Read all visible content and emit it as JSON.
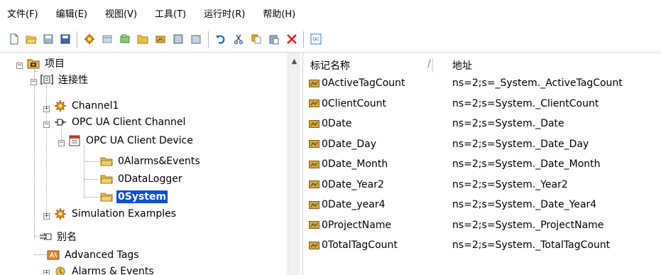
{
  "menu": {
    "items": [
      "文件(F)",
      "编辑(E)",
      "视图(V)",
      "工具(T)",
      "运行时(R)",
      "帮助(H)"
    ]
  },
  "toolbar": {
    "buttons": [
      {
        "icon": "new-file-icon",
        "color": "#ffffff"
      },
      {
        "icon": "open-folder-icon",
        "color": "#f2c744"
      },
      {
        "icon": "save-icon",
        "color": "#9fb6cf"
      },
      {
        "icon": "save-as-icon",
        "color": "#3a67b0"
      },
      {
        "icon": "new-channel-icon",
        "color": "#e89a1c"
      },
      {
        "icon": "new-device-icon",
        "color": "#c9d7e8"
      },
      {
        "icon": "new-tag-group-icon",
        "color": "#8cc47a"
      },
      {
        "icon": "new-folder-icon",
        "color": "#e8c048"
      },
      {
        "icon": "new-tag-icon",
        "color": "#e1a93a"
      },
      {
        "icon": "bulk-tag-icon",
        "color": "#a8b8c8"
      },
      {
        "icon": "properties-icon",
        "color": "#c7d4e2"
      },
      {
        "icon": "undo-icon",
        "color": "#1a66c8"
      },
      {
        "icon": "cut-icon",
        "color": "#4a6db0"
      },
      {
        "icon": "copy-icon",
        "color": "#e6b020"
      },
      {
        "icon": "paste-icon",
        "color": "#9fb0c4"
      },
      {
        "icon": "delete-icon",
        "color": "#e02020"
      },
      {
        "icon": "quick-client-icon",
        "color": "#3a7cc8"
      }
    ],
    "quick_client_text": "QC"
  },
  "tree": {
    "root": "项目",
    "connectivity": "连接性",
    "channel1": "Channel1",
    "opcua_channel": "OPC UA Client Channel",
    "opcua_device": "OPC UA Client Device",
    "alarms_events_group": "0Alarms&Events",
    "datalogger_group": "0DataLogger",
    "system_group": "0System",
    "simulation": "Simulation Examples",
    "aliases": "别名",
    "advanced_tags": "Advanced Tags",
    "alarms_events": "Alarms & Events"
  },
  "list": {
    "columns": {
      "name": "标记名称",
      "address": "地址"
    },
    "rows": [
      {
        "name": "0ActiveTagCount",
        "address": "ns=2;s=_System._ActiveTagCount"
      },
      {
        "name": "0ClientCount",
        "address": "ns=2;s=System._ClientCount"
      },
      {
        "name": "0Date",
        "address": "ns=2;s=System._Date"
      },
      {
        "name": "0Date_Day",
        "address": "ns=2;s=System._Date_Day"
      },
      {
        "name": "0Date_Month",
        "address": "ns=2;s=System._Date_Month"
      },
      {
        "name": "0Date_Year2",
        "address": "ns=2;s=System._Year2"
      },
      {
        "name": "0Date_year4",
        "address": "ns=2;s=System._Date_Year4"
      },
      {
        "name": "0ProjectName",
        "address": "ns=2;s=System._ProjectName"
      },
      {
        "name": "0TotalTagCount",
        "address": "ns=2;s=System._TotalTagCount"
      }
    ]
  },
  "colors": {
    "selection": "#0a50d8",
    "folder": "#e8b84a",
    "tag_icon": "#e0a23a"
  }
}
